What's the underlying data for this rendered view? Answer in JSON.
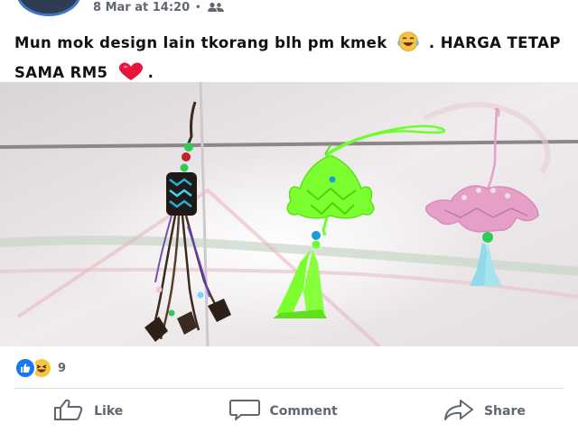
{
  "post": {
    "timestamp": "8 Mar at 14:20",
    "separator": "•",
    "audience_icon": "friends-icon",
    "caption_part1": "Mun mok design lain tkorang blh pm kmek",
    "caption_part2": ". HARGA TETAP SAMA RM5",
    "caption_end": ".",
    "photo_description_colors": {
      "wall": "#e7e3e4",
      "neon_green": "#6dff2a",
      "pink": "#e6a0c8",
      "light_blue": "#8fd6e8"
    }
  },
  "reactions": {
    "like_icon": "like-reaction-icon",
    "haha_icon": "haha-reaction-icon",
    "count": "9"
  },
  "actions": {
    "like_label": "Like",
    "comment_label": "Comment",
    "share_label": "Share"
  }
}
